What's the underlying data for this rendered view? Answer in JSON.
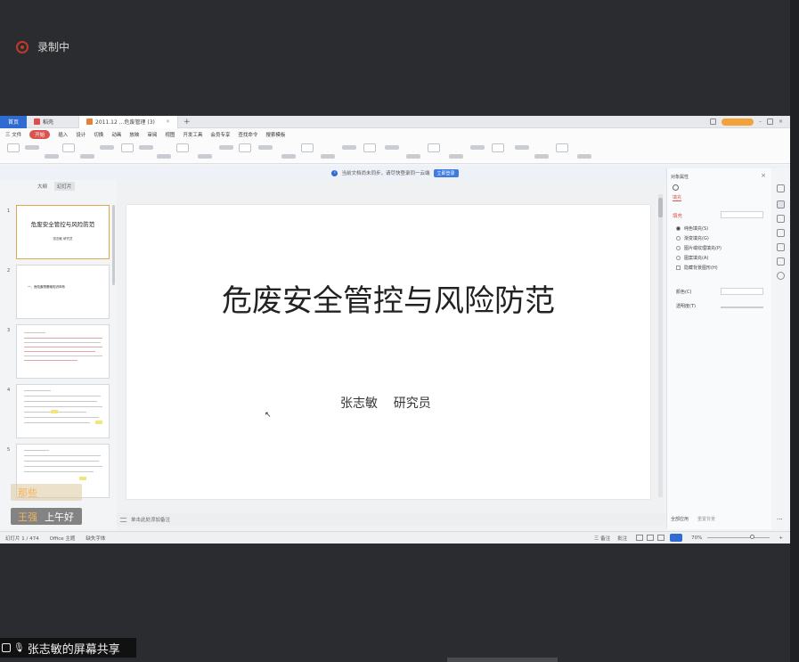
{
  "overlay": {
    "recording": "录制中",
    "screen_share": "张志敏的屏幕共享"
  },
  "tabs": [
    {
      "label": "首页"
    },
    {
      "label": "稻壳"
    },
    {
      "label": "2011.12 ...危废管理 (3)"
    }
  ],
  "tab_add": "+",
  "menu": [
    "三 文件",
    "开始",
    "插入",
    "设计",
    "切换",
    "动画",
    "放映",
    "审阅",
    "视图",
    "开发工具",
    "会员专享",
    "查找命令",
    "搜索模板"
  ],
  "menu_active_index": 1,
  "notice": {
    "text": "当前文档尚未同步，请尽快登录同一云端",
    "button": "立即登录"
  },
  "outline_tabs": [
    "大纲",
    "幻灯片"
  ],
  "slides": [
    {
      "num": "1",
      "title": "危废安全管控与风险防范",
      "subtitle": "张志敏  研究员"
    },
    {
      "num": "2",
      "title": "一、危险废物基础知识体系"
    },
    {
      "num": "3"
    },
    {
      "num": "4"
    },
    {
      "num": "5"
    }
  ],
  "main_slide": {
    "title": "危废安全管控与风险防范",
    "author": "张志敏    研究员"
  },
  "notes_placeholder": "单击此处添加备注",
  "right_panel": {
    "title": "对象属性",
    "tab": "填充",
    "section": "填充",
    "options": [
      "纯色填充(S)",
      "渐变填充(G)",
      "图片或纹理填充(P)",
      "图案填充(A)",
      "隐藏背景图形(H)"
    ],
    "selected_option": 0,
    "fields": [
      "颜色(C)",
      "透明度(T)"
    ],
    "footer": [
      "全部应用",
      "重置背景"
    ]
  },
  "status": {
    "slide_counter": "幻灯片 1 / 474",
    "theme": "Office 主题",
    "font_missing": "缺失字体",
    "notes_btn": "三 备注",
    "comment_btn": "批注",
    "zoom": "70%"
  },
  "chat": [
    {
      "name": "那些",
      "message": ""
    },
    {
      "name": "王强",
      "message": "上午好"
    }
  ]
}
